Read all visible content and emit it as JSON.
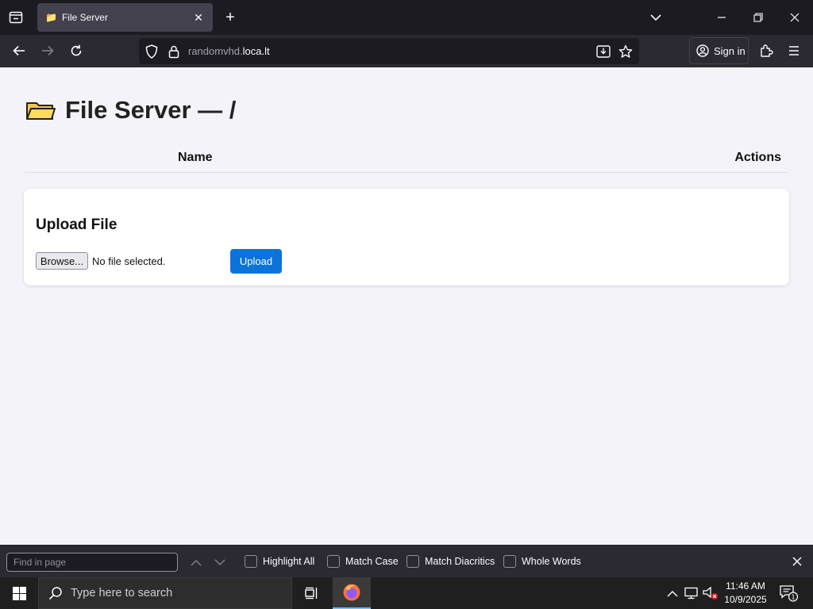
{
  "browser": {
    "tab": {
      "title": "File Server",
      "favicon": "folder-icon"
    },
    "url": {
      "prefix": "randomvhd.",
      "domain": "loca.lt"
    },
    "signin_label": "Sign in"
  },
  "page": {
    "heading": "File Server — /",
    "table": {
      "col_name": "Name",
      "col_actions": "Actions"
    },
    "upload": {
      "title": "Upload File",
      "browse_label": "Browse...",
      "file_status": "No file selected.",
      "upload_label": "Upload"
    }
  },
  "findbar": {
    "placeholder": "Find in page",
    "options": [
      "Highlight All",
      "Match Case",
      "Match Diacritics",
      "Whole Words"
    ]
  },
  "taskbar": {
    "search_placeholder": "Type here to search",
    "time": "11:46 AM",
    "date": "10/9/2025",
    "notification_count": "1"
  },
  "colors": {
    "accent": "#0a74da",
    "tabstrip": "#1c1b22",
    "toolbar": "#2b2a33",
    "page_bg": "#f4f3f9"
  }
}
